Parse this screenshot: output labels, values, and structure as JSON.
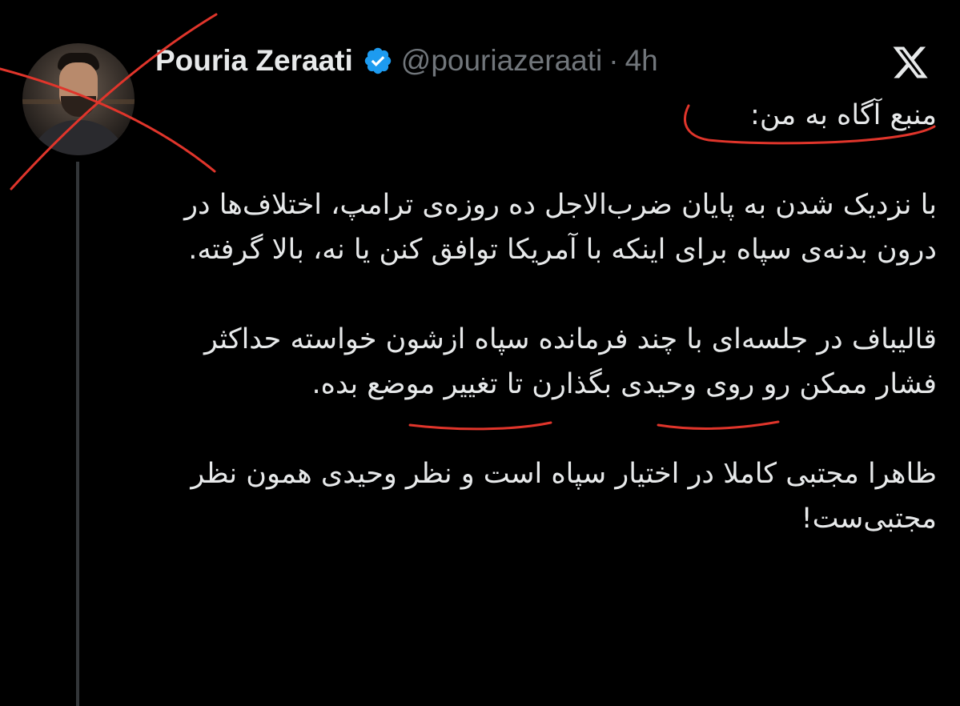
{
  "author": {
    "display_name": "Pouria Zeraati",
    "handle": "@pouriazeraati",
    "separator": "·",
    "time": "4h"
  },
  "icons": {
    "verified": "verified-badge-icon",
    "platform": "x-logo-icon",
    "avatar": "profile-photo"
  },
  "tweet": {
    "source_line": "منبع آگاه به من:",
    "paragraph_1": "با نزدیک شدن به پایان ضرب‌الاجل ده روزه‌ی ترامپ، اختلاف‌ها در درون بدنه‌ی سپاه برای اینکه با آمریکا توافق کنن یا نه، بالا گرفته.",
    "paragraph_2": "قالیباف در جلسه‌ای با چند فرمانده سپاه ازشون خواسته حداکثر فشار ممکن رو روی وحیدی بگذارن تا تغییر موضع بده.",
    "paragraph_3": "ظاهرا مجتبی کاملا در اختیار سپاه است و نظر وحیدی همون نظر مجتبی‌ست!"
  },
  "colors": {
    "background": "#000000",
    "text": "#e7e9ea",
    "muted": "#71767b",
    "verified_blue": "#1d9bf0",
    "annotation_red": "#e0352b"
  }
}
